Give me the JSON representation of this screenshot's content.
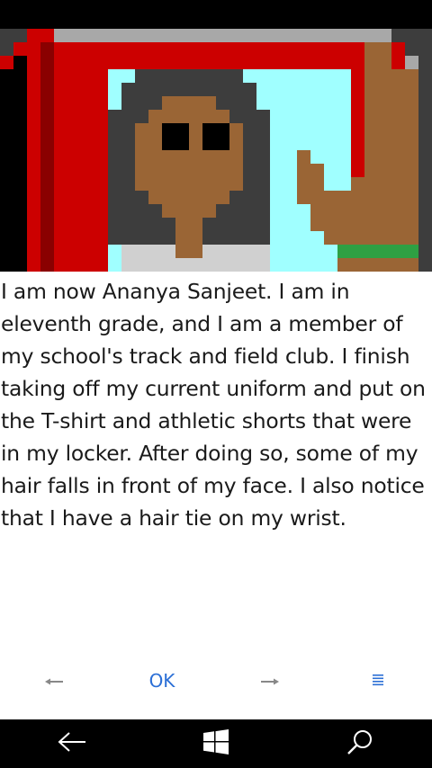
{
  "story": {
    "text": "I am now Ananya Sanjeet. I am in eleventh grade, and I am a member of my school's track and field club. I finish taking off my current uniform and put on the T-shirt and athletic shorts that were in my locker. After doing so, some of my hair falls in front of my face. I also notice that I have a hair tie on my wrist."
  },
  "app_bar": {
    "ok_label": "OK",
    "prev_icon": "arrow-left-icon",
    "next_icon": "arrow-right-icon",
    "menu_icon": "hamburger-menu-icon",
    "accent_color": "#2b6fd6"
  },
  "nav_bar": {
    "back_icon": "back-arrow-icon",
    "home_icon": "windows-logo-icon",
    "search_icon": "search-icon"
  },
  "colors": {
    "locker_red": "#cc0000",
    "sky": "#a0ffff",
    "skin": "#9a6535",
    "hair": "#3d3d3d",
    "band_green": "#2ea043"
  }
}
